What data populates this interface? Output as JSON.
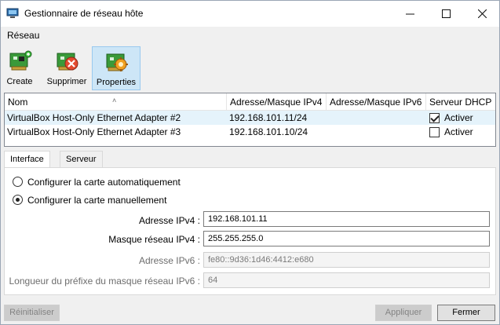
{
  "window": {
    "title": "Gestionnaire de réseau hôte"
  },
  "menu": [
    "Réseau"
  ],
  "toolbar": [
    {
      "label": "Create",
      "icon": "network-card-add-icon",
      "active": false
    },
    {
      "label": "Supprimer",
      "icon": "network-card-remove-icon",
      "active": false
    },
    {
      "label": "Properties",
      "icon": "network-card-properties-icon",
      "active": true
    }
  ],
  "table": {
    "headers": [
      "Nom",
      "Adresse/Masque IPv4",
      "Adresse/Masque IPv6",
      "Serveur DHCP"
    ],
    "rows": [
      {
        "name": "VirtualBox Host-Only Ethernet Adapter #2",
        "ipv4": "192.168.101.11/24",
        "ipv6": "",
        "dhcp_label": "Activer",
        "dhcp_checked": true,
        "selected": true
      },
      {
        "name": "VirtualBox Host-Only Ethernet Adapter #3",
        "ipv4": "192.168.101.10/24",
        "ipv6": "",
        "dhcp_label": "Activer",
        "dhcp_checked": false,
        "selected": false
      }
    ]
  },
  "tabs": [
    {
      "label": "Interface",
      "active": true
    },
    {
      "label": "Serveur DHCP",
      "active": false
    }
  ],
  "interface": {
    "radio_auto": "Configurer la carte automatiquement",
    "radio_manual": "Configurer la carte manuellement",
    "selected": "manual",
    "ipv4_label": "Adresse IPv4 :",
    "ipv4_value": "192.168.101.11",
    "mask_label": "Masque réseau IPv4 :",
    "mask_value": "255.255.255.0",
    "ipv6_label": "Adresse IPv6 :",
    "ipv6_value": "fe80::9d36:1d46:4412:e680",
    "prefix_label": "Longueur du préfixe du masque réseau IPv6 :",
    "prefix_value": "64"
  },
  "buttons": {
    "reset": "Réinitialiser",
    "apply": "Appliquer",
    "close": "Fermer"
  },
  "colors": {
    "selection": "#e5f3fb",
    "toolbar_active": "#cde6f7"
  }
}
